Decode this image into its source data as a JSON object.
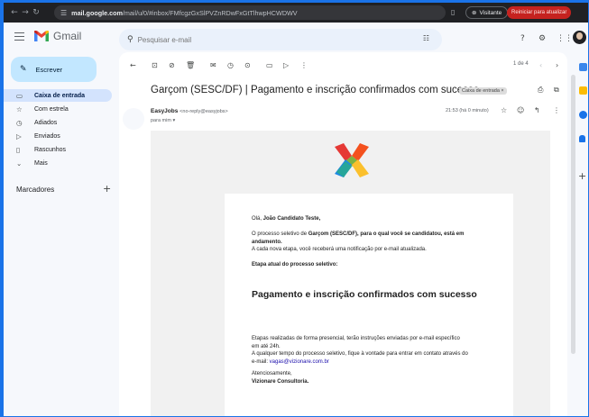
{
  "browser": {
    "url_prefix": "mail.google.com",
    "url_rest": "/mail/u/0/#inbox/FMfcgzGxSlPVZnRDwFxGtTlhwpHCWDWV",
    "visitor_label": "Visitante",
    "restart_label": "Reiniciar para atualizar"
  },
  "app": {
    "name": "Gmail"
  },
  "search": {
    "placeholder": "Pesquisar e-mail"
  },
  "sidebar": {
    "compose_label": "Escrever",
    "items": [
      {
        "label": "Caixa de entrada",
        "icon": "inbox-icon"
      },
      {
        "label": "Com estrela",
        "icon": "star-icon"
      },
      {
        "label": "Adiados",
        "icon": "clock-icon"
      },
      {
        "label": "Enviados",
        "icon": "send-icon"
      },
      {
        "label": "Rascunhos",
        "icon": "draft-icon"
      },
      {
        "label": "Mais",
        "icon": "chevron-down-icon"
      }
    ],
    "labels_heading": "Marcadores"
  },
  "toolbar": {
    "pager": "1 de 4"
  },
  "email": {
    "subject": "Garçom (SESC/DF) | Pagamento e inscrição confirmados com sucesso",
    "inbox_chip": "Caixa de entrada ×",
    "sender_name": "EasyJobs",
    "sender_email": "<no-reply@easyjobs>",
    "to": "para mim ▾",
    "time": "21:53 (há 0 minuto)",
    "body": {
      "greeting_prefix": "Olá, ",
      "greeting_name": "João Candidato Teste,",
      "p1_prefix": "O processo seletivo de ",
      "p1_bold": "Garçom (SESC/DF), para o qual você se candidatou, está em andamento.",
      "p2": "A cada nova etapa, você receberá uma notificação por e-mail atualizada.",
      "stage_label": "Etapa atual do processo seletivo:",
      "stage_title": "Pagamento e inscrição confirmados com sucesso",
      "p3": "Etapas realizadas de forma presencial, terão instruções enviadas por e-mail específico em até 24h.",
      "p4_prefix": "A qualquer tempo do processo seletivo, fique à vontade para entrar em contato através do e-mail: ",
      "p4_email": "vagas@vizionare.com.br",
      "signoff": "Atenciosamente,",
      "company": "Vizionare Consultoria."
    }
  },
  "colors": {
    "accent": "#1a73e8",
    "compose_bg": "#c2e7ff",
    "active_item_bg": "#d3e3fd",
    "restart_bg": "#c5221f"
  }
}
